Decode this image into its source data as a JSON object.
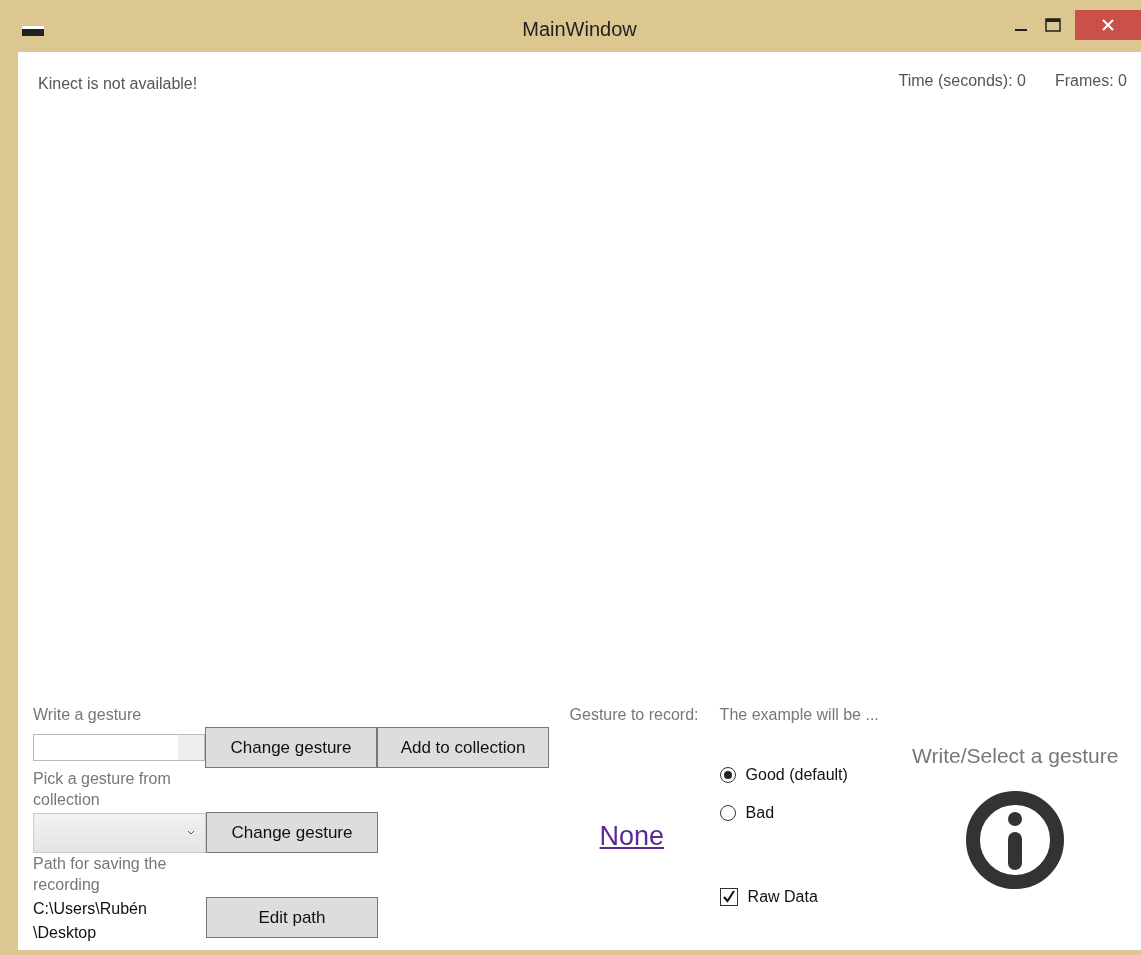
{
  "window": {
    "title": "MainWindow"
  },
  "status": {
    "message": "Kinect is not available!",
    "time": "Time (seconds): 0",
    "frames": "Frames: 0"
  },
  "write_gesture": {
    "label": "Write a gesture",
    "buttons": [
      "Change gesture",
      "Add to collection"
    ]
  },
  "pick_gesture": {
    "label": "Pick a gesture from collection",
    "buttons": [
      "Change gesture"
    ]
  },
  "path": {
    "label": "Path for saving the recording",
    "value": "C:\\Users\\Rubén\\Desktop",
    "buttons": [
      "Edit path"
    ]
  },
  "gesture_to_record": {
    "label": "Gesture to record:",
    "value": "None"
  },
  "example": {
    "label": "The example will be ...",
    "options": [
      {
        "label": "Good (default)",
        "selected": true
      },
      {
        "label": "Bad",
        "selected": false
      }
    ]
  },
  "raw_data": {
    "label": "Raw Data",
    "checked": true
  },
  "hint": {
    "text": "Write/Select a gesture"
  }
}
